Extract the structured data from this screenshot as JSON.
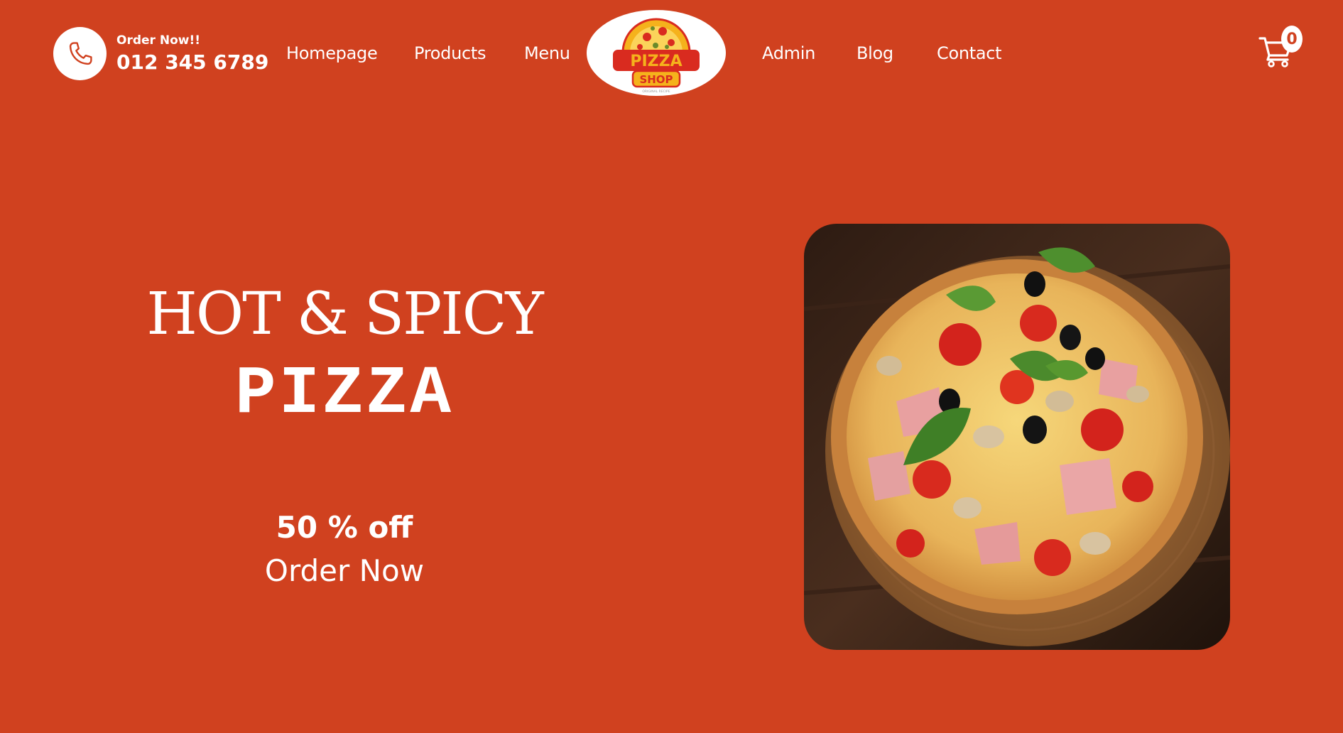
{
  "header": {
    "order_label": "Order Now!!",
    "phone": "012 345 6789",
    "nav_left": [
      "Homepage",
      "Products",
      "Menu"
    ],
    "nav_right": [
      "Admin",
      "Blog",
      "Contact"
    ],
    "logo": {
      "line1": "PIZZA",
      "line2": "SHOP",
      "tagline": "ORIGINAL RECIPE"
    },
    "cart_count": "0"
  },
  "hero": {
    "subtitle": "HOT & SPICY",
    "title": "PIZZA",
    "discount": "50 % off",
    "cta": "Order Now"
  },
  "icons": {
    "phone": "phone-icon",
    "cart": "shopping-cart-icon",
    "hero_image": "pizza-photo"
  },
  "colors": {
    "background": "#d0411f",
    "text": "#ffffff",
    "logo_red": "#d92b1f",
    "logo_yellow": "#f5b21c"
  }
}
